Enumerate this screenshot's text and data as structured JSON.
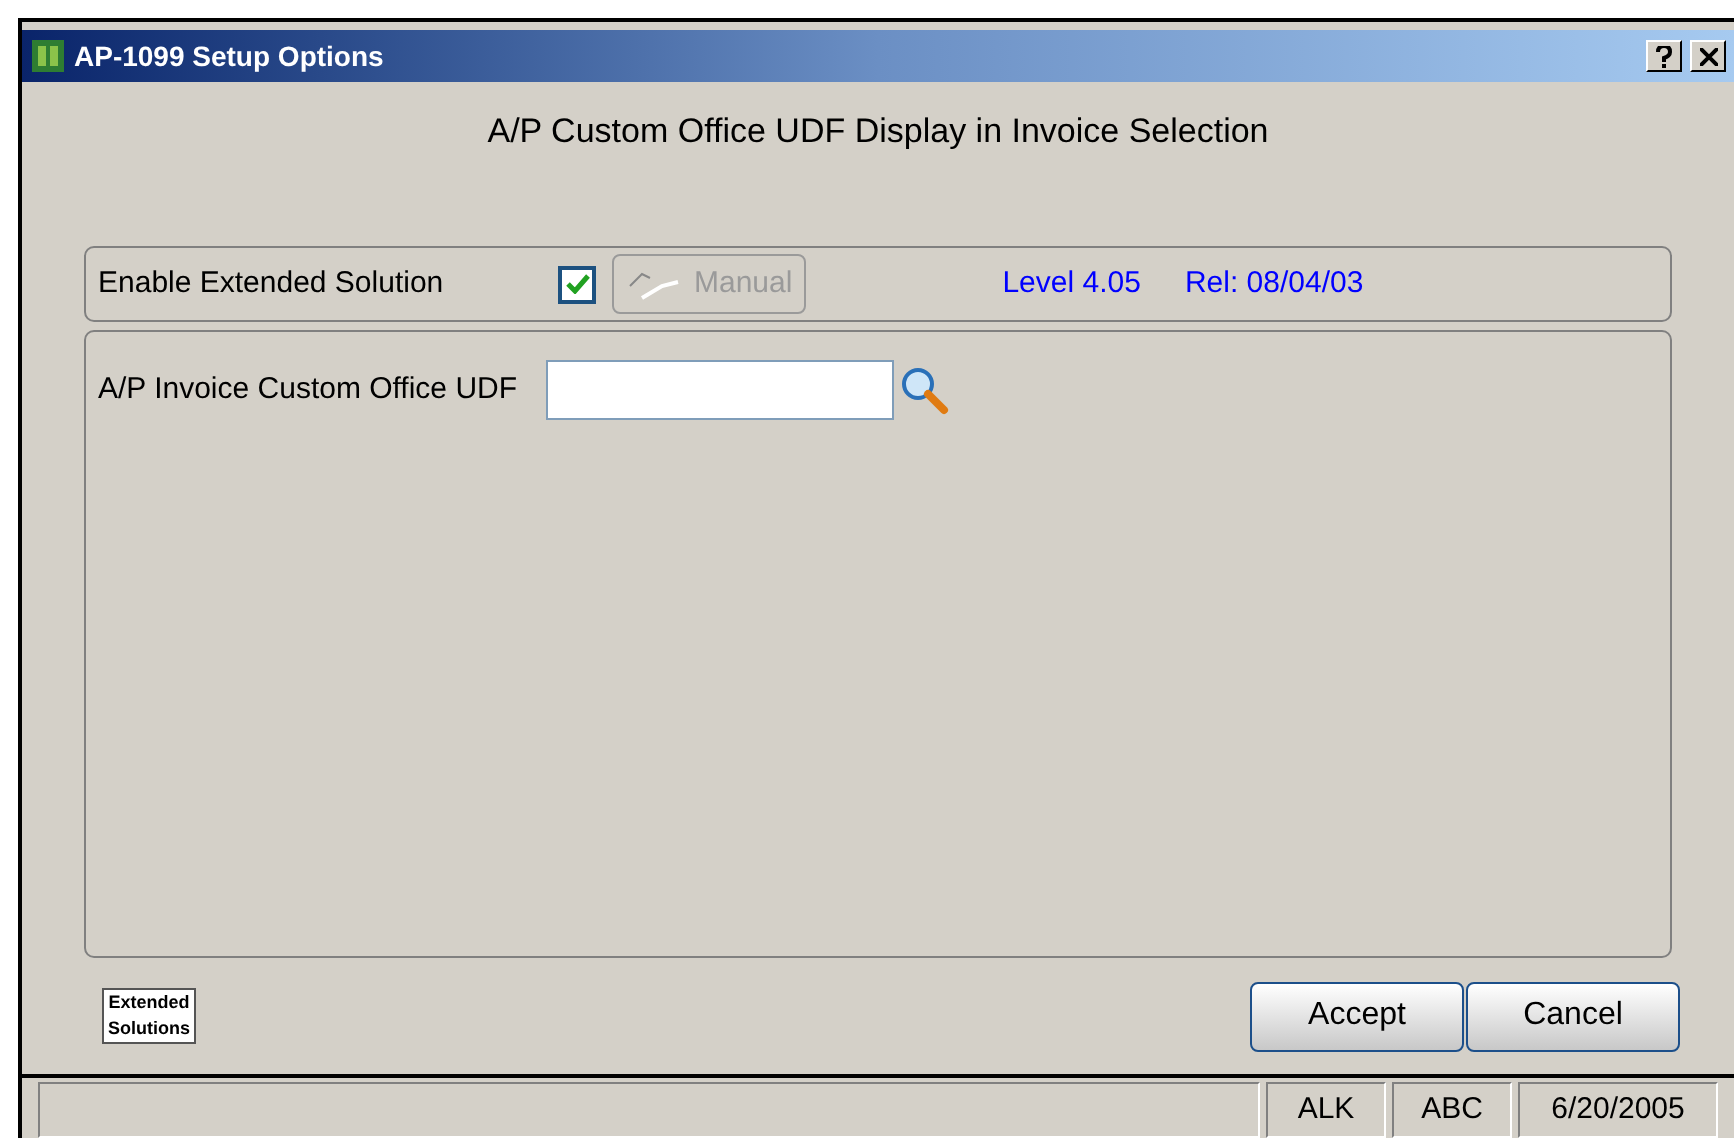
{
  "window": {
    "title": "AP-1099 Setup Options"
  },
  "heading": "A/P Custom Office UDF Display in Invoice Selection",
  "extended": {
    "label": "Enable Extended Solution",
    "checked": true,
    "manual_button": {
      "label": "Manual",
      "disabled": true
    },
    "level": "Level 4.05",
    "release": "Rel: 08/04/03"
  },
  "field": {
    "label": "A/P Invoice Custom Office UDF"
  },
  "logo": [
    "Extended",
    "Solutions"
  ],
  "buttons": [
    "Accept",
    "Cancel"
  ],
  "status_bar": [
    "ALK",
    "ABC",
    "6/20/2005"
  ]
}
